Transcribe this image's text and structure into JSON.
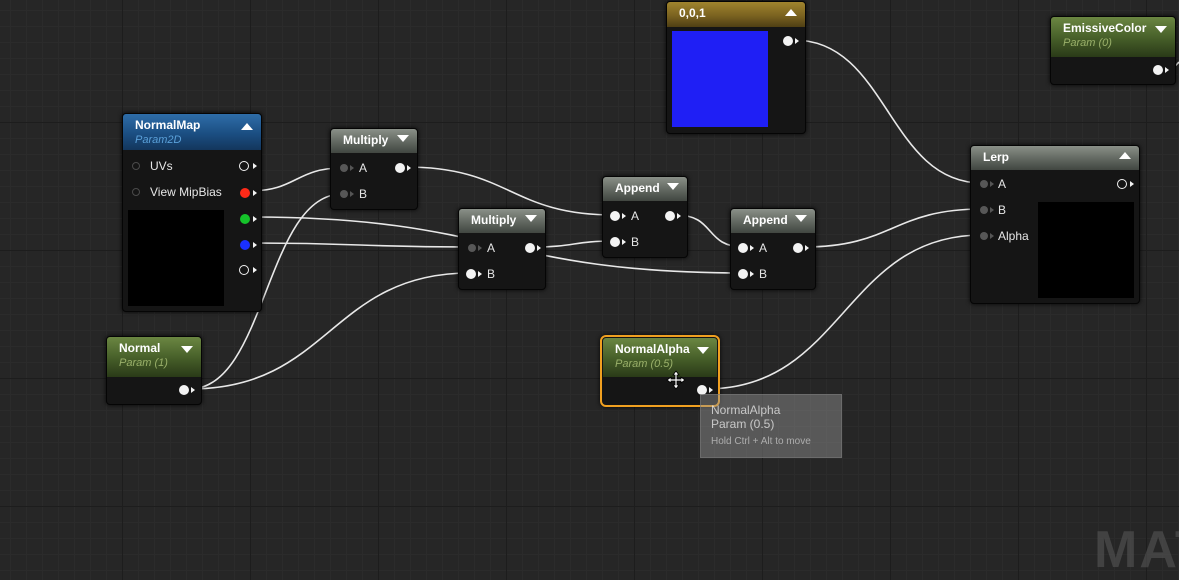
{
  "graph": {
    "watermark": "MAT"
  },
  "nodes": {
    "normal_map": {
      "title": "NormalMap",
      "subtitle": "Param2D",
      "pins": {
        "uvs": "UVs",
        "view_mip_bias": "View MipBias"
      }
    },
    "normal": {
      "title": "Normal",
      "subtitle": "Param (1)"
    },
    "multiply_1": {
      "title": "Multiply",
      "pin_a": "A",
      "pin_b": "B"
    },
    "multiply_2": {
      "title": "Multiply",
      "pin_a": "A",
      "pin_b": "B"
    },
    "append_1": {
      "title": "Append",
      "pin_a": "A",
      "pin_b": "B"
    },
    "append_2": {
      "title": "Append",
      "pin_a": "A",
      "pin_b": "B"
    },
    "constant_vector": {
      "title": "0,0,1",
      "preview_color": "#1f1ff5"
    },
    "emissive_color": {
      "title": "EmissiveColor",
      "subtitle": "Param (0)"
    },
    "lerp": {
      "title": "Lerp",
      "pin_a": "A",
      "pin_b": "B",
      "pin_alpha": "Alpha"
    },
    "normal_alpha": {
      "title": "NormalAlpha",
      "subtitle": "Param (0.5)",
      "selected": true,
      "selection_color": "#f0a020"
    }
  },
  "tooltip": {
    "name": "NormalAlpha",
    "param": "Param (0.5)",
    "hint": "Hold Ctrl + Alt to move"
  },
  "colors": {
    "pin_red": "#ff2a18",
    "pin_green": "#15c32a",
    "pin_blue": "#1a30ff",
    "wire": "#e8e8e8"
  }
}
